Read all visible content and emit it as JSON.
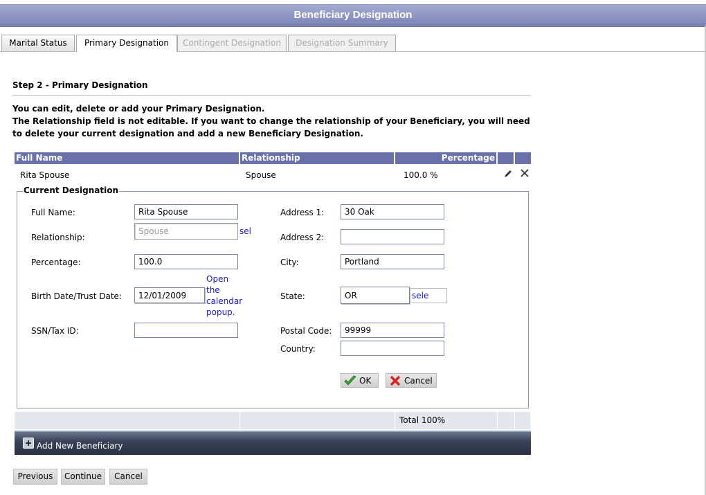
{
  "window": {
    "title": "Beneficiary Designation"
  },
  "tabs": [
    {
      "label": "Marital Status",
      "state": "normal"
    },
    {
      "label": "Primary Designation",
      "state": "active"
    },
    {
      "label": "Contingent Designation",
      "state": "disabled"
    },
    {
      "label": "Designation Summary",
      "state": "disabled"
    }
  ],
  "step": {
    "heading": "Step 2 - Primary Designation"
  },
  "info": {
    "line1": "You can edit, delete or add your Primary Designation.",
    "line2": "The Relationship field is not editable. If you want to change the relationship of your Beneficiary, you will need to delete your current designation and add a new Beneficiary Designation."
  },
  "grid": {
    "columns": [
      "Full Name",
      "Relationship",
      "Percentage"
    ],
    "rows": [
      {
        "full_name": "Rita Spouse",
        "relationship": "Spouse",
        "percentage": "100.0 %"
      }
    ],
    "footer_total": "Total 100%"
  },
  "colors": {
    "header_bg": "#6a70aa",
    "title_bg": "#8c93c4",
    "add_bar_bg": "#2f364c",
    "link": "#1a1ad0"
  },
  "form": {
    "legend": "Current Designation",
    "full_name": {
      "label": "Full Name:",
      "value": "Rita Spouse"
    },
    "relationship": {
      "label": "Relationship:",
      "value": "Spouse",
      "select_link": "sele"
    },
    "percentage": {
      "label": "Percentage:",
      "value": "100.0"
    },
    "birth_date": {
      "label": "Birth Date/Trust Date:",
      "value": "12/01/2009",
      "calendar_link": "Open the calendar popup."
    },
    "ssn": {
      "label": "SSN/Tax ID:",
      "value": ""
    },
    "address1": {
      "label": "Address 1:",
      "value": "30 Oak"
    },
    "address2": {
      "label": "Address 2:",
      "value": ""
    },
    "city": {
      "label": "City:",
      "value": "Portland"
    },
    "state": {
      "label": "State:",
      "value": "OR",
      "select_link": "sele"
    },
    "postal_code": {
      "label": "Postal Code:",
      "value": "99999"
    },
    "country": {
      "label": "Country:",
      "value": ""
    },
    "ok_label": "OK",
    "cancel_label": "Cancel"
  },
  "add_new_label": "Add New Beneficiary",
  "nav": {
    "previous": "Previous",
    "continue": "Continue",
    "cancel": "Cancel"
  }
}
